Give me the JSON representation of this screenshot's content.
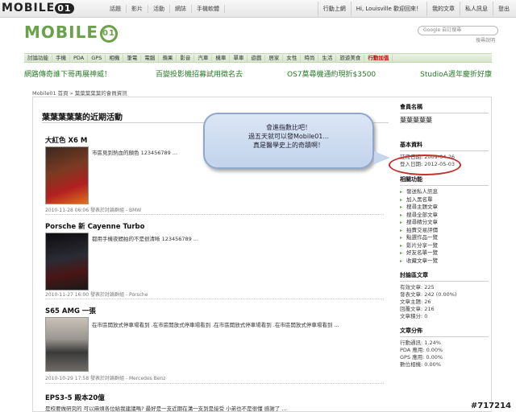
{
  "topbar": {
    "logo": "MOBILE",
    "logo_mark": "01",
    "nav": [
      "話題",
      "影片",
      "活動",
      "網誌",
      "手機軟體"
    ],
    "right": [
      "行動上網",
      "Hi, Louisville 歡迎回來！",
      "我的文章",
      "私人訊息",
      "登出"
    ]
  },
  "header": {
    "brand": "MOBILE",
    "brand_mark": "01",
    "search_placeholder": "自訂搜尋",
    "search_help": "搜尋說明"
  },
  "mainnav": [
    "討論功能",
    "手機",
    "PDA",
    "GPS",
    "相機",
    "筆電",
    "電腦",
    "蘋果",
    "影音",
    "汽車",
    "機車",
    "單車",
    "遊戲",
    "居家",
    "女性",
    "時尚",
    "生活",
    "旅遊美食",
    "行動加值"
  ],
  "promo": [
    "網路傳奇誰下哥再展神威！",
    "百變投影機招募試用徵名去",
    "OS7莫尋機通約現折$3500",
    "StudioA週年慶折好康"
  ],
  "breadcrumb": "Mobile01 首頁 » 葉葉葉葉葉的會員資訊",
  "activity": {
    "title": "葉葉葉葉葉的近期活動",
    "posts": [
      {
        "title": "大紅色 X6 M",
        "desc": "市區見到熱血的顏色 123456789 ...",
        "meta": "2010-11-28 06:06 發表於討論群組 - BMW"
      },
      {
        "title": "Porsche 新 Cayenne Turbo",
        "desc": "都用手機夜間拍的不是很清晰 123456789 ...",
        "meta": "2010-11-27 16:00 發表於討論群組 - Porsche"
      },
      {
        "title": "S65 AMG 一張",
        "desc": "在市區開放式停車場看到 .在市區開放式停車場看到 .在市區開放式停車場看到 .在市區開放式停車場看到 ...",
        "meta": "2010-10-29 17:58 發表於討論群組 - Mercedes Benz"
      },
      {
        "title": "EPS3-5 殿本20億",
        "desc": "是校要做研究的 可以麻煩各位給我建議嗎? 最好是一支近期在溝一支到是接受 小弟也不是很懂 感謝了 ..."
      }
    ]
  },
  "sidebar": {
    "member_label": "會員名稱",
    "member_name": "葉葉葉葉葉",
    "basic_label": "基本資料",
    "reg_date": "註冊日期: 2009-04-26",
    "login_date": "登入日期: 2012-05-03",
    "func_label": "相關功能",
    "funcs": [
      "發送私人訊息",
      "加入黑名單",
      "搜尋主題文章",
      "搜尋全部文章",
      "搜尋精分文章",
      "拍賣交易評價",
      "點選作品一覽",
      "影片分享一覽",
      "好友名單一覽",
      "收藏文章一覽"
    ],
    "stats_label": "討論區文章",
    "stats": [
      "有效文章: 225",
      "發表文章: 242 (0.00%)",
      "文章主題: 26",
      "回覆文章: 216",
      "文章積分: 0"
    ],
    "dist_label": "文章分佈",
    "dist": [
      "行動通訊: 1.24%",
      "PDA 應用: 0.00%",
      "GPS 應用: 0.00%",
      "數位相機: 0.00%"
    ]
  },
  "bubble": {
    "lines": [
      "會進指數比吧！",
      "過五天就可以發Mobile01...",
      "真是醫學史上的奇蹟啊！"
    ]
  },
  "watermark": "#717214"
}
